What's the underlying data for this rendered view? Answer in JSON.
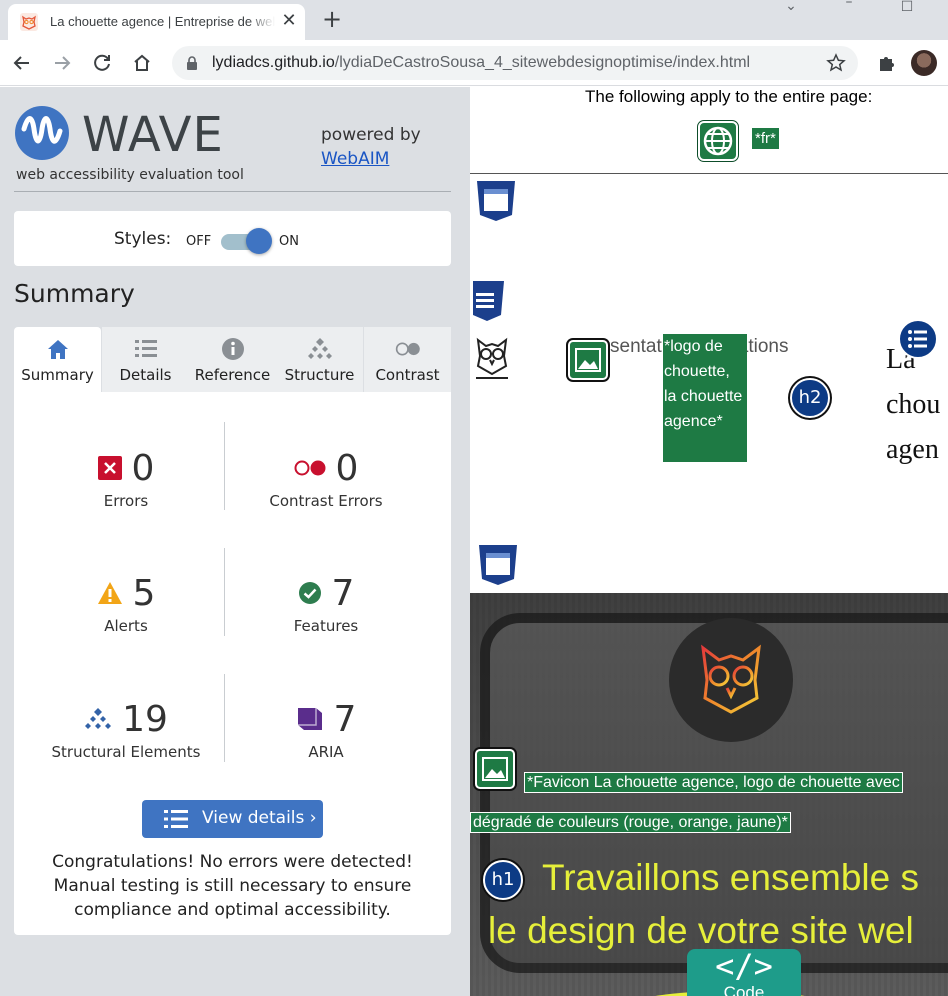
{
  "browser": {
    "tab_title": "La chouette agence | Entreprise de web design",
    "url_host": "lydiadcs.github.io",
    "url_path": "/lydiaDeCastroSousa_4_sitewebdesignoptimise/index.html"
  },
  "wave": {
    "brand": "WAVE",
    "subtitle": "web accessibility evaluation tool",
    "powered_by": "powered by",
    "webaim_link": "WebAIM",
    "styles_label": "Styles:",
    "toggle_off": "OFF",
    "toggle_on": "ON",
    "styles_on": true,
    "summary_heading": "Summary",
    "tabs": [
      {
        "label": "Summary",
        "icon": "home-icon",
        "active": true
      },
      {
        "label": "Details",
        "icon": "list-icon",
        "active": false
      },
      {
        "label": "Reference",
        "icon": "info-icon",
        "active": false
      },
      {
        "label": "Structure",
        "icon": "hierarchy-icon",
        "active": false
      },
      {
        "label": "Contrast",
        "icon": "contrast-icon",
        "active": false
      }
    ],
    "stats": {
      "errors": {
        "value": "0",
        "label": "Errors"
      },
      "contrast_errors": {
        "value": "0",
        "label": "Contrast Errors"
      },
      "alerts": {
        "value": "5",
        "label": "Alerts"
      },
      "features": {
        "value": "7",
        "label": "Features"
      },
      "structural": {
        "value": "19",
        "label": "Structural Elements"
      },
      "aria": {
        "value": "7",
        "label": "ARIA"
      }
    },
    "view_details": "View details ›",
    "congrats": "Congratulations! No errors were detected! Manual testing is still necessary to ensure compliance and optimal accessibility.",
    "colors": {
      "accent": "#3f74c2",
      "error": "#c8102e",
      "alert": "#f2a517",
      "feature": "#2e7d4f",
      "structural": "#3363a8",
      "aria": "#5a2d8c"
    }
  },
  "page": {
    "apply_text": "The following apply to the entire page:",
    "lang_tag": "*fr*",
    "nav_text": "sentat       os réalisations",
    "logo_alt": "*logo de chouette, la chouette agence*",
    "h2_label": "h2",
    "serif_text": "La chou agen",
    "favicon_alt": "*Favicon La chouette agence, logo de chouette avec dégradé de couleurs (rouge, orange, jaune)*",
    "h1_label": "h1",
    "h1_text": "Travaillons ensemble s le design de votre site wel",
    "code_symbol": "</>",
    "code_word": "Code"
  }
}
